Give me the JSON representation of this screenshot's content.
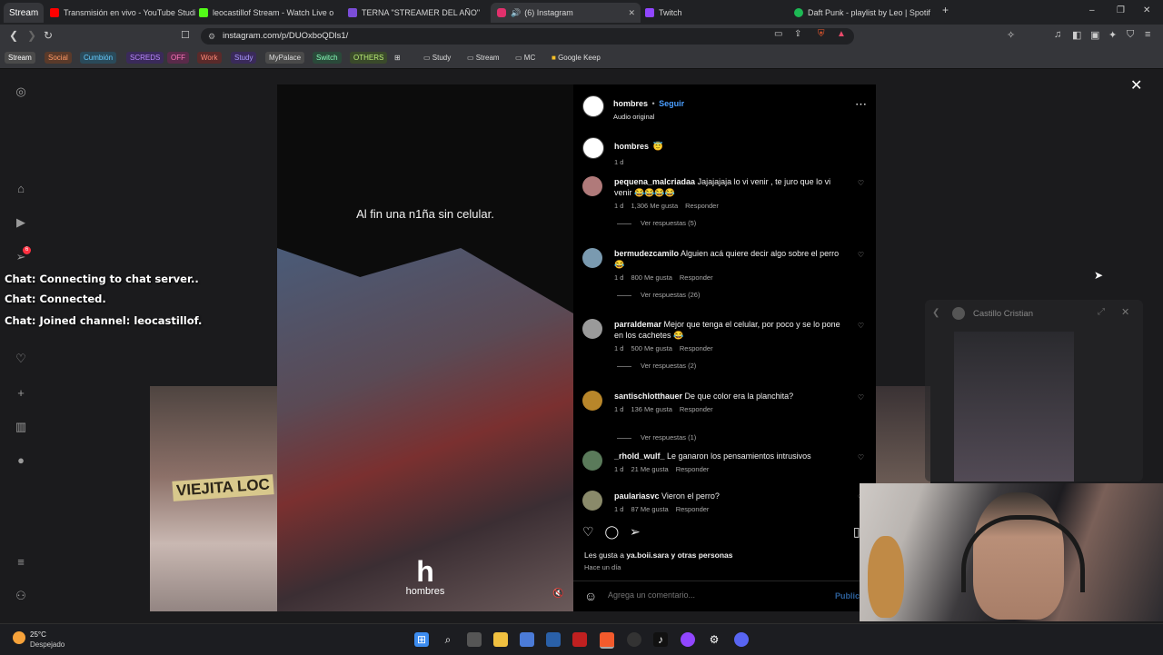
{
  "browser": {
    "tabs": [
      {
        "title": "Transmisión en vivo - YouTube Studio",
        "color": "#ff0000"
      },
      {
        "title": "leocastillof Stream - Watch Live on K",
        "color": "#53fc18"
      },
      {
        "title": "TERNA \"STREAMER DEL AÑO\"",
        "color": "#7b4dd8"
      },
      {
        "title": "(6) Instagram",
        "color": "#e1306c",
        "active": true
      },
      {
        "title": "Twitch",
        "color": "#9146ff"
      },
      {
        "title": "Daft Punk - playlist by Leo | Spotify",
        "color": "#1db954"
      }
    ],
    "tab_close": "✕",
    "new_tab": "+",
    "window": {
      "minimize": "–",
      "restore": "❐",
      "close": "✕"
    },
    "url": "instagram.com/p/DUOxboQDls1/",
    "bookmarks_colored": [
      {
        "label": "Stream",
        "bg": "#4a4a4a",
        "fg": "#ffffff"
      },
      {
        "label": "Social",
        "bg": "#5a3a2a",
        "fg": "#ff9966"
      },
      {
        "label": "Cumbión",
        "bg": "#2a4a5a",
        "fg": "#66ccff"
      },
      {
        "label": "SCREDS",
        "bg": "#3a2a5a",
        "fg": "#bb88ff"
      },
      {
        "label": "OFF",
        "bg": "#5a2a4a",
        "fg": "#ff77bb"
      },
      {
        "label": "Work",
        "bg": "#5a2a2a",
        "fg": "#ff8877"
      },
      {
        "label": "Study",
        "bg": "#3a2a5a",
        "fg": "#aa99ff"
      },
      {
        "label": "MyPalace",
        "bg": "#4a4a4a",
        "fg": "#dddddd"
      },
      {
        "label": "Switch",
        "bg": "#2a4a3a",
        "fg": "#88ffbb"
      },
      {
        "label": "OTHERS",
        "bg": "#3a4a2a",
        "fg": "#bbee77"
      }
    ],
    "bookmark_folders": [
      "Study",
      "Stream",
      "MC",
      "Google Keep"
    ]
  },
  "video": {
    "caption": "Al fin una n1ña sin celular.",
    "logo_letter": "h",
    "logo_word": "hombres",
    "overlay_text": "VIEJITA LOC"
  },
  "post": {
    "author": "hombres",
    "follow": "Seguir",
    "separator": "•",
    "audio": "Audio original",
    "caption_author": "hombres",
    "caption_emoji": "😇",
    "caption_time": "1 d",
    "more": "⋯"
  },
  "comments": [
    {
      "user": "pequena_malcriadaa",
      "text": "Jajajajaja lo vi venir , te juro que lo vi venir 😂😂😂😂",
      "time": "1 d",
      "likes": "1,306 Me gusta",
      "reply": "Responder",
      "replies": "Ver respuestas (5)",
      "avatar": "#b07a7a"
    },
    {
      "user": "bermudezcamilo",
      "text": "Alguien acá quiere decir algo sobre el perro 😂",
      "time": "1 d",
      "likes": "800 Me gusta",
      "reply": "Responder",
      "replies": "Ver respuestas (26)",
      "avatar": "#7a9ab0"
    },
    {
      "user": "parraldemar",
      "text": "Mejor que tenga el celular, por poco y se lo pone en los cachetes 😂",
      "time": "1 d",
      "likes": "500 Me gusta",
      "reply": "Responder",
      "replies": "Ver respuestas (2)",
      "avatar": "#9a9a9a"
    },
    {
      "user": "santischlotthauer",
      "text": "De que color era la planchita?",
      "time": "1 d",
      "likes": "136 Me gusta",
      "reply": "Responder",
      "replies": "Ver respuestas (1)",
      "avatar": "#b8862a"
    },
    {
      "user": "_rhold_wulf_",
      "text": "Le ganaron los pensamientos intrusivos",
      "time": "1 d",
      "likes": "21 Me gusta",
      "reply": "Responder",
      "replies": "",
      "avatar": "#5a7a5a"
    },
    {
      "user": "paulariasvc",
      "text": "Vieron el perro?",
      "time": "1 d",
      "likes": "87 Me gusta",
      "reply": "Responder",
      "replies": "",
      "avatar": "#8a8a6a"
    }
  ],
  "post_footer": {
    "likes_prefix": "Les gusta a",
    "likes_user": "ya.boii.sara",
    "likes_suffix": "y otras personas",
    "ago": "Hace un día",
    "add_comment_placeholder": "Agrega un comentario...",
    "publish": "Publicar",
    "emoji_icon": "☺"
  },
  "chat_overlay": [
    "Chat: Connecting to chat server..",
    "Chat: Connected.",
    "Chat: Joined channel: leocastillof."
  ],
  "pip": {
    "title": "Castillo Cristian"
  },
  "nav_badge": "6",
  "taskbar": {
    "temp": "25°C",
    "weather": "Despejado"
  }
}
